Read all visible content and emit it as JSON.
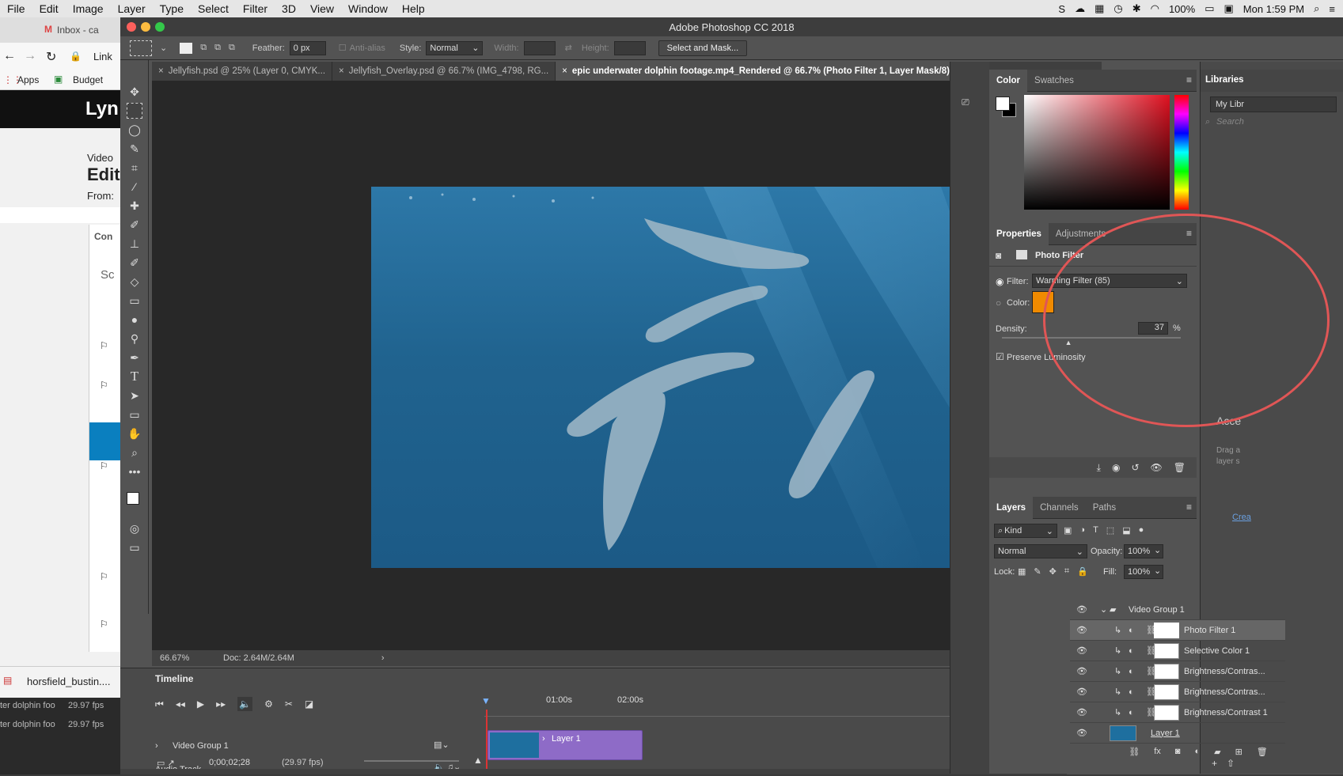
{
  "menubar": {
    "apple": "",
    "items": [
      "File",
      "Edit",
      "Image",
      "Layer",
      "Type",
      "Select",
      "Filter",
      "3D",
      "View",
      "Window",
      "Help"
    ],
    "battery": "100%",
    "clock": "Mon 1:59 PM"
  },
  "browser": {
    "tab": "Inbox - ca",
    "bookmark_apps": "Apps",
    "bookmark_budget": "Budget",
    "link_frag": "Link",
    "lyn": "Lyn",
    "video": "Video",
    "edit": "Edit",
    "from": "From:",
    "con": "Con",
    "sc": "Sc",
    "download": "horsfield_bustin....",
    "rows": [
      {
        "name": "ter dolphin foo",
        "fps": "29.97 fps"
      },
      {
        "name": "ter dolphin foo",
        "fps": "29.97 fps"
      }
    ]
  },
  "app": {
    "title": "Adobe Photoshop CC 2018"
  },
  "options": {
    "feather_label": "Feather:",
    "feather_value": "0 px",
    "antialias": "Anti-alias",
    "style_label": "Style:",
    "style_value": "Normal",
    "width_label": "Width:",
    "height_label": "Height:",
    "select_mask": "Select and Mask..."
  },
  "tabs": [
    {
      "label": "Jellyfish.psd @ 25% (Layer 0, CMYK..."
    },
    {
      "label": "Jellyfish_Overlay.psd @ 66.7% (IMG_4798, RG..."
    },
    {
      "label": "epic underwater dolphin footage.mp4_Rendered @ 66.7% (Photo Filter 1, Layer Mask/8) *"
    }
  ],
  "status": {
    "zoom": "66.67%",
    "doc": "Doc: 2.64M/2.64M"
  },
  "timeline": {
    "title": "Timeline",
    "t1": "01:00s",
    "t2": "02:00s",
    "group": "Video Group 1",
    "clip": "Layer 1",
    "audio": "Audio Track",
    "timecode": "0;00;02;28",
    "fps": "(29.97 fps)"
  },
  "color_panel": {
    "tab_color": "Color",
    "tab_swatches": "Swatches"
  },
  "libraries": {
    "title": "Libraries",
    "my": "My Libr",
    "search": "Search",
    "acce": "Acce",
    "drag": "Drag a",
    "layer": "layer s",
    "crea": "Crea"
  },
  "properties": {
    "tab_props": "Properties",
    "tab_adj": "Adjustments",
    "title": "Photo Filter",
    "filter_label": "Filter:",
    "filter_value": "Warming Filter (85)",
    "color_label": "Color:",
    "density_label": "Density:",
    "density_value": "37",
    "density_unit": "%",
    "density_fraction": 0.37,
    "preserve": "Preserve Luminosity",
    "swatch_color": "#f08a00"
  },
  "layers": {
    "tab_layers": "Layers",
    "tab_channels": "Channels",
    "tab_paths": "Paths",
    "kind": "Kind",
    "blend": "Normal",
    "opacity_label": "Opacity:",
    "opacity": "100%",
    "lock_label": "Lock:",
    "fill_label": "Fill:",
    "fill": "100%",
    "rows": [
      {
        "name": "Video Group 1"
      },
      {
        "name": "Photo Filter 1"
      },
      {
        "name": "Selective Color 1"
      },
      {
        "name": "Brightness/Contras..."
      },
      {
        "name": "Brightness/Contras..."
      },
      {
        "name": "Brightness/Contrast 1"
      },
      {
        "name": "Layer 1"
      }
    ]
  }
}
